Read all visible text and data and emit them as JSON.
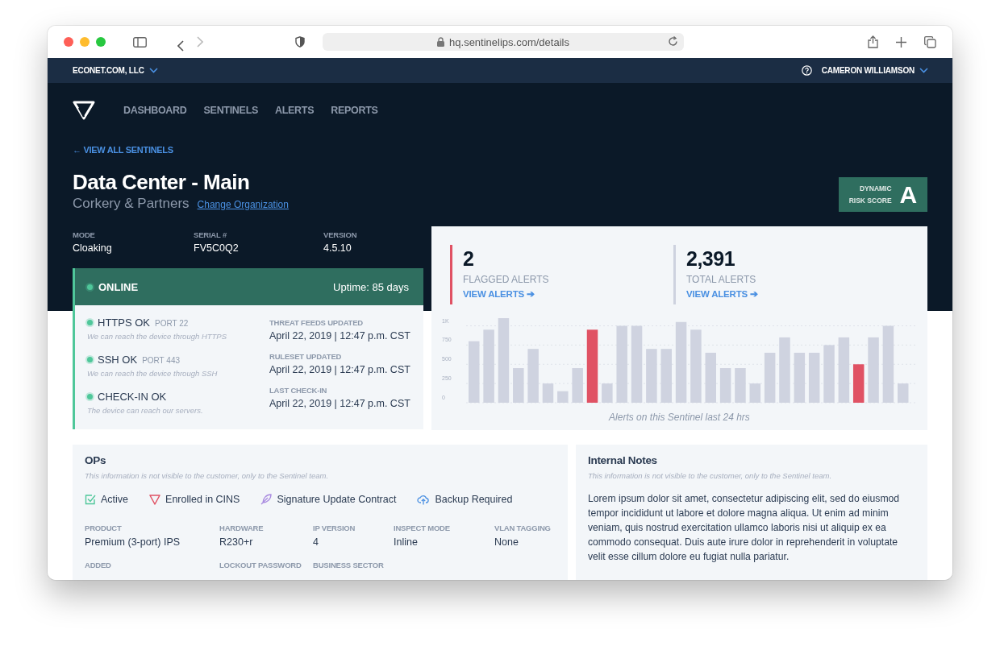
{
  "browser": {
    "url": "hq.sentinelips.com/details"
  },
  "topbar": {
    "organization": "ECONET.COM, LLC",
    "user": "CAMERON WILLIAMSON"
  },
  "nav": {
    "items": [
      "DASHBOARD",
      "SENTINELS",
      "ALERTS",
      "REPORTS"
    ]
  },
  "back_link": "← VIEW ALL SENTINELS",
  "title": "Data Center - Main",
  "organization": "Corkery & Partners",
  "change_link": "Change Organization",
  "risk_score": {
    "label_1": "DYNAMIC",
    "label_2": "RISK SCORE",
    "grade": "A"
  },
  "meta": [
    {
      "label": "MODE",
      "value": "Cloaking"
    },
    {
      "label": "SERIAL #",
      "value": "FV5C0Q2"
    },
    {
      "label": "VERSION",
      "value": "4.5.10"
    }
  ],
  "status": {
    "state": "ONLINE",
    "uptime": "Uptime: 85 days",
    "checks": [
      {
        "name": "HTTPS OK",
        "port": "PORT 22",
        "note": "We can reach the device through HTTPS"
      },
      {
        "name": "SSH OK",
        "port": "PORT 443",
        "note": "We can reach the device through SSH"
      },
      {
        "name": "CHECK-IN OK",
        "note": "The device can reach our servers."
      }
    ],
    "updates": [
      {
        "label": "THREAT FEEDS UPDATED",
        "value": "April 22, 2019 | 12:47 p.m. CST"
      },
      {
        "label": "RULESET UPDATED",
        "value": "April 22, 2019 | 12:47 p.m. CST"
      },
      {
        "label": "LAST CHECK-IN",
        "value": "April 22, 2019 | 12:47 p.m. CST"
      }
    ]
  },
  "alerts": {
    "stats": [
      {
        "value": "2",
        "label": "FLAGGED ALERTS",
        "link": "VIEW ALERTS ➔",
        "color": "#e05264"
      },
      {
        "value": "2,391",
        "label": "TOTAL ALERTS",
        "link": "VIEW ALERTS ➔",
        "color": "#cdd2df"
      }
    ],
    "caption": "Alerts on this Sentinel last 24 hrs",
    "chart_data": {
      "type": "bar",
      "stacked": true,
      "grid": true,
      "ylim": [
        0,
        1100
      ],
      "yticks": [
        0,
        250,
        500,
        750,
        {
          "value": 1000,
          "label": "1K"
        }
      ],
      "series": [
        {
          "color": "#cfd3e0",
          "values": [
            800,
            950,
            1100,
            450,
            700,
            250,
            150,
            450,
            null,
            250,
            1000,
            1000,
            700,
            700,
            1050,
            950,
            650,
            450,
            450,
            250,
            650,
            850,
            650,
            650,
            750,
            850,
            null,
            850,
            1000,
            250
          ]
        },
        {
          "color": "#e05264",
          "values": [
            null,
            null,
            null,
            null,
            null,
            null,
            null,
            null,
            950,
            null,
            null,
            null,
            null,
            null,
            null,
            null,
            null,
            null,
            null,
            null,
            null,
            null,
            null,
            null,
            null,
            null,
            500,
            null,
            null,
            null
          ]
        }
      ]
    }
  },
  "ops": {
    "title": "OPs",
    "note": "This information is not visible to the customer, only to the Sentinel team.",
    "flags": [
      {
        "kind": "check",
        "label": "Active"
      },
      {
        "kind": "triangle",
        "label": "Enrolled in CINS"
      },
      {
        "kind": "feather",
        "label": "Signature Update Contract"
      },
      {
        "kind": "cloud",
        "label": "Backup Required"
      }
    ],
    "fields": [
      {
        "label": "PRODUCT",
        "value": "Premium (3-port) IPS"
      },
      {
        "label": "HARDWARE",
        "value": "R230+r"
      },
      {
        "label": "IP VERSION",
        "value": "4"
      },
      {
        "label": "INSPECT MODE",
        "value": "Inline"
      },
      {
        "label": "VLAN TAGGING",
        "value": "None"
      },
      {
        "label": "ADDED"
      },
      {
        "label": "LOCKOUT PASSWORD"
      },
      {
        "label": "BUSINESS SECTOR"
      }
    ]
  },
  "notes": {
    "title": "Internal Notes",
    "note": "This information is not visible to the customer, only to the Sentinel team.",
    "body": "Lorem ipsum dolor sit amet, consectetur adipiscing elit, sed do eiusmod tempor incididunt ut labore et dolore magna aliqua. Ut enim ad minim veniam, quis nostrud exercitation ullamco laboris nisi ut aliquip ex ea commodo consequat. Duis aute irure dolor in reprehenderit in voluptate velit esse cillum dolore eu fugiat nulla pariatur."
  }
}
